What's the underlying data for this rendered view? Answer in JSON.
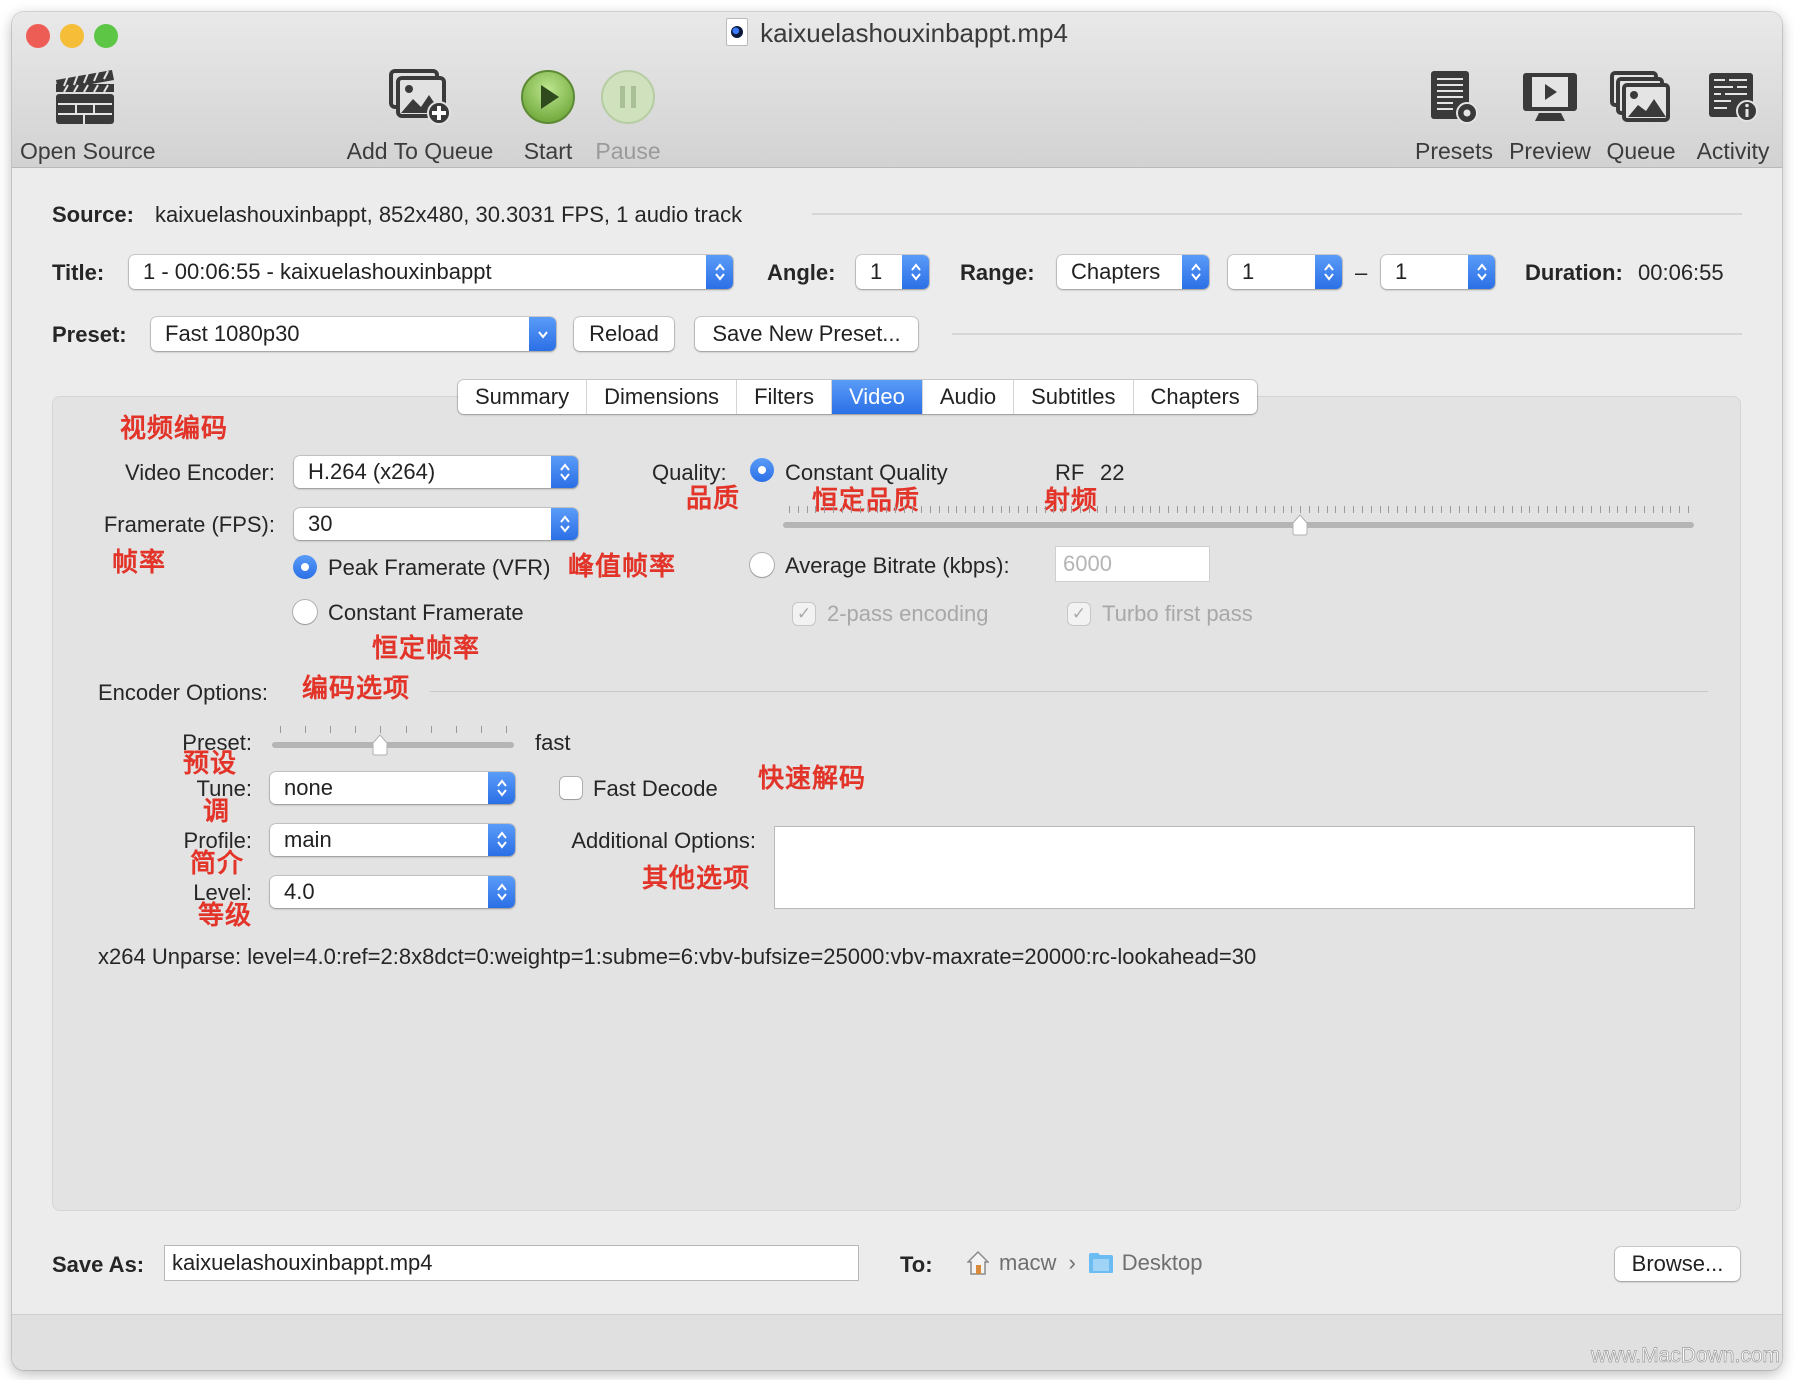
{
  "window": {
    "title": "kaixuelashouxinbappt.mp4",
    "traffic_lights": {
      "close": "#ee5d55",
      "minimize": "#f5bd38",
      "zoom": "#5dc644"
    }
  },
  "toolbar": {
    "items": [
      {
        "id": "open-source",
        "label": "Open Source",
        "icon": "clapperboard-icon",
        "enabled": true
      },
      {
        "id": "add-to-queue",
        "label": "Add To Queue",
        "icon": "add-to-queue-icon",
        "enabled": true
      },
      {
        "id": "start",
        "label": "Start",
        "icon": "play-icon",
        "enabled": true
      },
      {
        "id": "pause",
        "label": "Pause",
        "icon": "pause-icon",
        "enabled": false
      },
      {
        "id": "presets",
        "label": "Presets",
        "icon": "presets-icon",
        "enabled": true
      },
      {
        "id": "preview",
        "label": "Preview",
        "icon": "preview-monitor-icon",
        "enabled": true
      },
      {
        "id": "queue",
        "label": "Queue",
        "icon": "queue-stack-icon",
        "enabled": true
      },
      {
        "id": "activity",
        "label": "Activity",
        "icon": "activity-log-icon",
        "enabled": true
      }
    ]
  },
  "source": {
    "label": "Source:",
    "value": "kaixuelashouxinbappt, 852x480, 30.3031 FPS, 1 audio track"
  },
  "title_row": {
    "title_label": "Title:",
    "title_value": "1 - 00:06:55 - kaixuelashouxinbappt",
    "angle_label": "Angle:",
    "angle_value": "1",
    "range_label": "Range:",
    "range_type": "Chapters",
    "range_start": "1",
    "range_separator": "–",
    "range_end": "1",
    "duration_label": "Duration:",
    "duration_value": "00:06:55"
  },
  "preset_row": {
    "label": "Preset:",
    "value": "Fast 1080p30",
    "reload_label": "Reload",
    "save_new_label": "Save New Preset..."
  },
  "tabs": [
    {
      "label": "Summary",
      "active": false
    },
    {
      "label": "Dimensions",
      "active": false
    },
    {
      "label": "Filters",
      "active": false
    },
    {
      "label": "Video",
      "active": true
    },
    {
      "label": "Audio",
      "active": false
    },
    {
      "label": "Subtitles",
      "active": false
    },
    {
      "label": "Chapters",
      "active": false
    }
  ],
  "video": {
    "encoder_label": "Video Encoder:",
    "encoder_value": "H.264 (x264)",
    "framerate_label": "Framerate (FPS):",
    "framerate_value": "30",
    "peak_framerate_label": "Peak Framerate (VFR)",
    "peak_framerate_selected": true,
    "constant_framerate_label": "Constant Framerate",
    "constant_framerate_selected": false,
    "quality_label": "Quality:",
    "constant_quality_label": "Constant Quality",
    "constant_quality_selected": true,
    "rf_label": "RF",
    "rf_value": "22",
    "rf_slider": {
      "min": 0,
      "max": 51,
      "value": 22,
      "inverted": true
    },
    "avg_bitrate_label": "Average Bitrate (kbps):",
    "avg_bitrate_selected": false,
    "avg_bitrate_value": "6000",
    "two_pass_label": "2-pass encoding",
    "two_pass_checked": true,
    "turbo_label": "Turbo first pass",
    "turbo_checked": true
  },
  "encoder_options": {
    "label": "Encoder Options:",
    "preset_label": "Preset:",
    "preset_value": "fast",
    "preset_slider": {
      "steps": 10,
      "index": 4
    },
    "tune_label": "Tune:",
    "tune_value": "none",
    "fast_decode_label": "Fast Decode",
    "fast_decode_checked": false,
    "profile_label": "Profile:",
    "profile_value": "main",
    "additional_label": "Additional Options:",
    "additional_value": "",
    "level_label": "Level:",
    "level_value": "4.0",
    "unparse": "x264 Unparse: level=4.0:ref=2:8x8dct=0:weightp=1:subme=6:vbv-bufsize=25000:vbv-maxrate=20000:rc-lookahead=30"
  },
  "annotations": {
    "video_encoding": "视频编码",
    "framerate": "帧率",
    "peak_framerate": "峰值帧率",
    "constant_framerate": "恒定帧率",
    "quality": "品质",
    "constant_quality": "恒定品质",
    "rf": "射频",
    "encoder_options": "编码选项",
    "preset": "预设",
    "tune": "调",
    "profile": "简介",
    "level": "等级",
    "fast_decode": "快速解码",
    "additional_options": "其他选项",
    "color": "#e3342a"
  },
  "save": {
    "label": "Save As:",
    "value": "kaixuelashouxinbappt.mp4",
    "to_label": "To:",
    "path": [
      {
        "name": "macw",
        "icon": "home-icon"
      },
      {
        "name": "Desktop",
        "icon": "folder-icon"
      }
    ],
    "path_separator": "›",
    "browse_label": "Browse..."
  },
  "watermark": "www.MacDown.com"
}
